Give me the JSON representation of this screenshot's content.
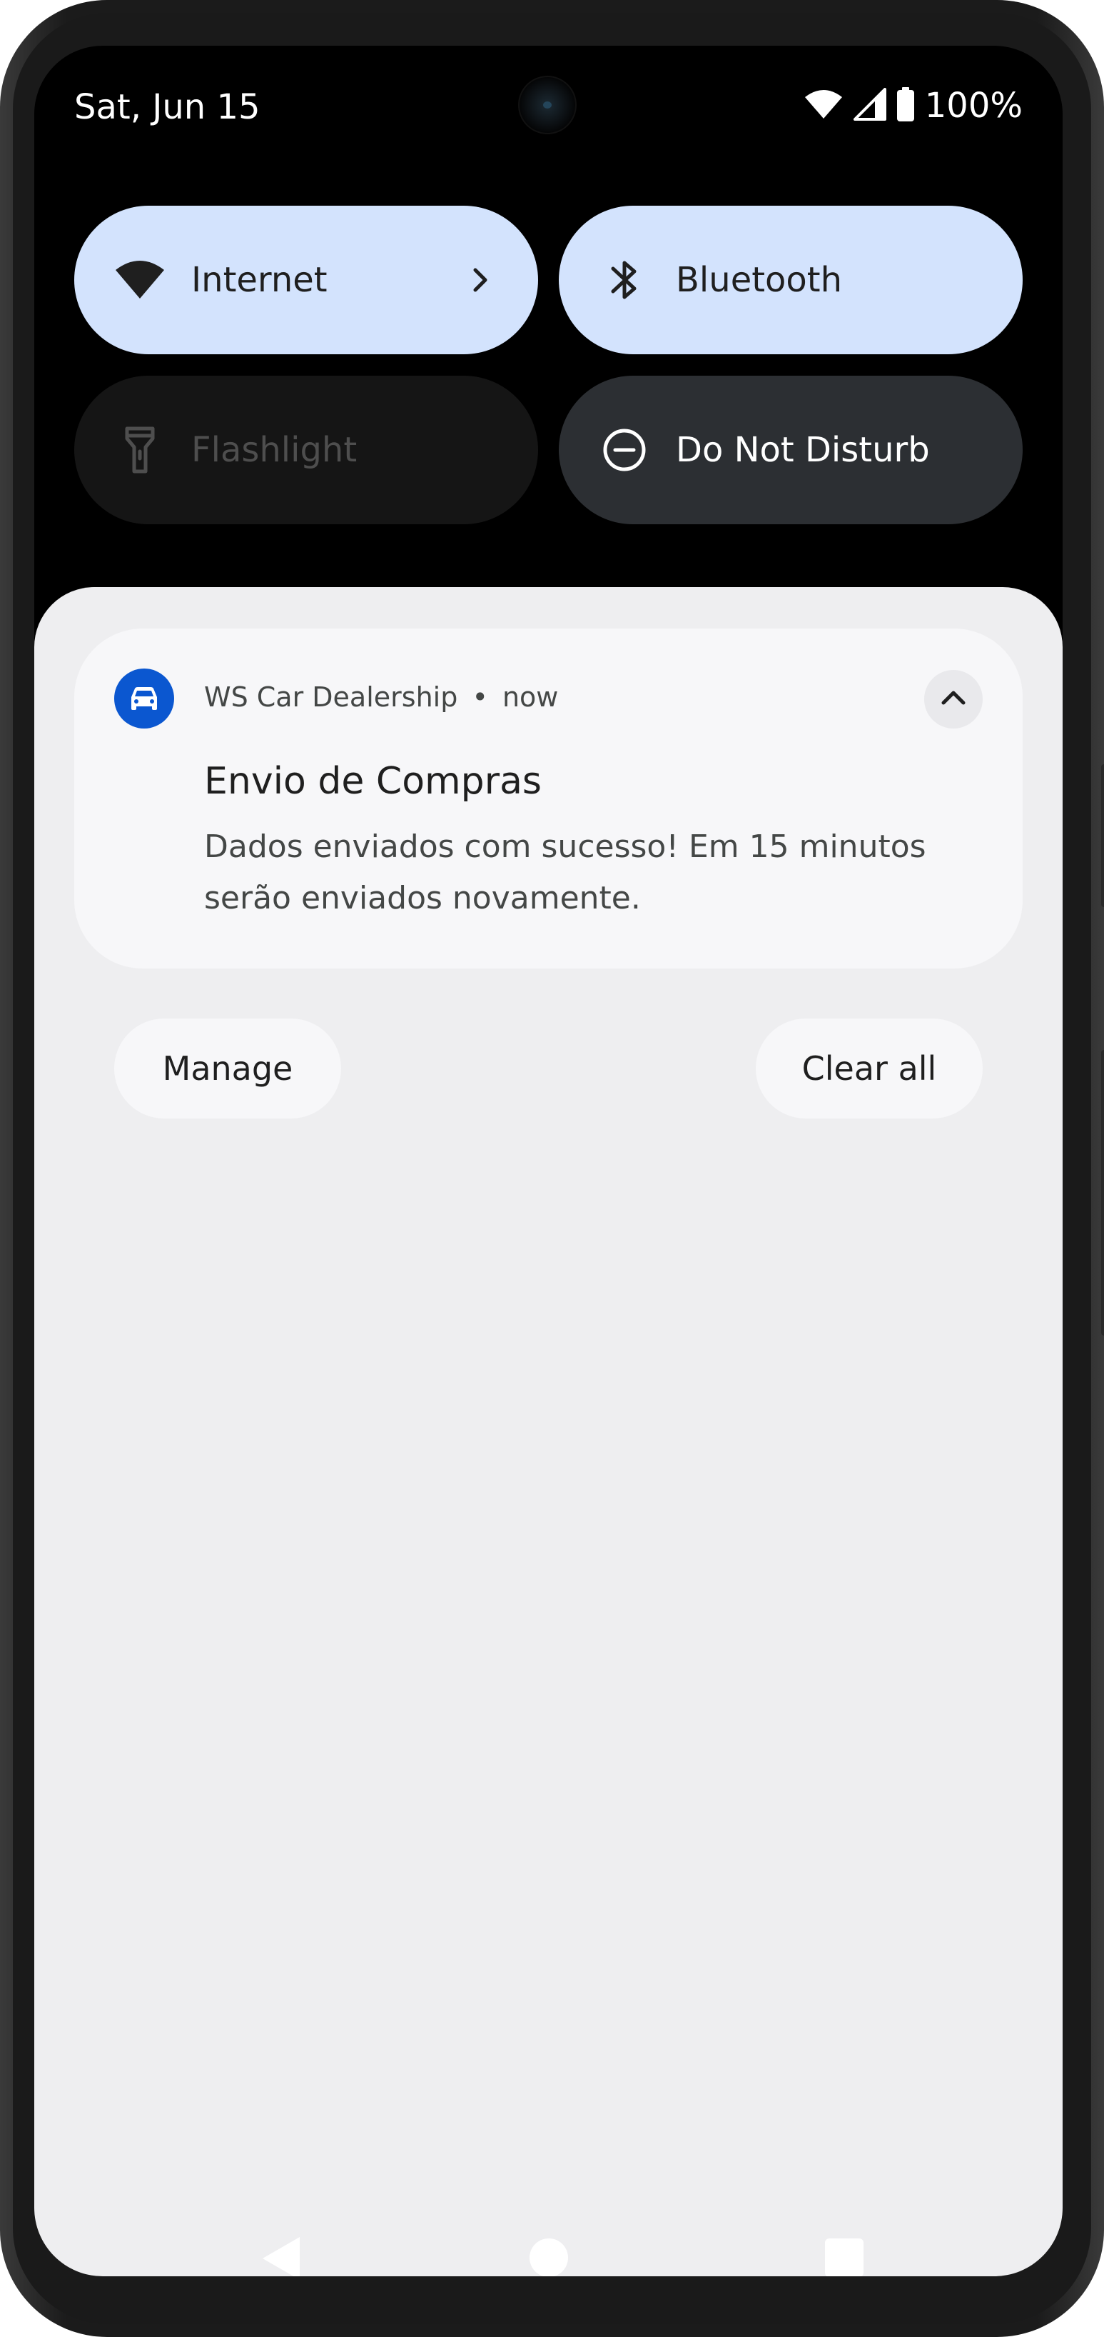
{
  "status_bar": {
    "date": "Sat, Jun 15",
    "battery_percent": "100%",
    "icons": [
      "wifi-icon",
      "cell-signal-icon",
      "battery-icon"
    ]
  },
  "quick_settings": {
    "tiles": [
      {
        "label": "Internet",
        "icon": "wifi-icon",
        "state": "on",
        "has_chevron": true
      },
      {
        "label": "Bluetooth",
        "icon": "bluetooth-icon",
        "state": "on"
      },
      {
        "label": "Flashlight",
        "icon": "flashlight-icon",
        "state": "unavailable"
      },
      {
        "label": "Do Not Disturb",
        "icon": "do-not-disturb-icon",
        "state": "off"
      }
    ]
  },
  "notification": {
    "app_icon": "car-icon",
    "app_name": "WS Car Dealership",
    "separator": "•",
    "time": "now",
    "title": "Envio de Compras",
    "body": "Dados enviados com sucesso! Em 15 minutos serão enviados novamente.",
    "expand_icon": "chevron-up-icon"
  },
  "actions": {
    "manage_label": "Manage",
    "clear_all_label": "Clear all"
  },
  "navigation": {
    "icons": [
      "back-icon",
      "home-icon",
      "recents-icon"
    ]
  },
  "colors": {
    "tile_on": "#d3e3fd",
    "tile_off": "#2c2f33",
    "shade_bg": "#eeeef0",
    "app_icon_bg": "#0b57d0"
  }
}
